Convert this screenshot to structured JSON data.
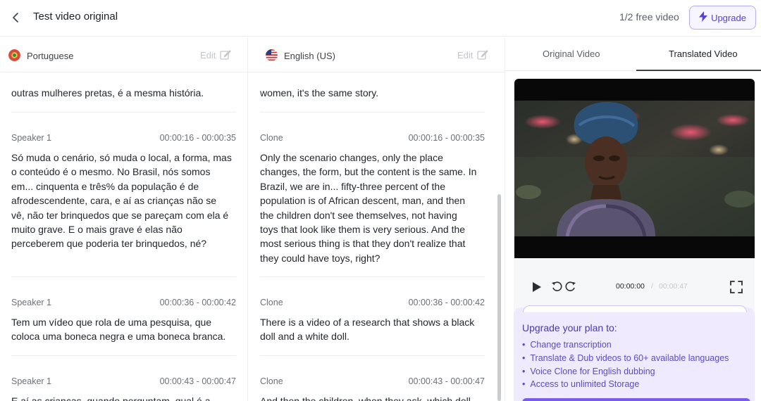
{
  "header": {
    "title": "Test video original",
    "free_count": "1/2 free video",
    "upgrade_label": "Upgrade"
  },
  "source": {
    "language": "Portuguese",
    "edit_label": "Edit",
    "top_fragment": "outras mulheres pretas, é a mesma história.",
    "segments": [
      {
        "speaker": "Speaker 1",
        "time": "00:00:16 - 00:00:35",
        "lines": [
          "Só muda o cenário, só muda o local, a forma, mas",
          "o conteúdo é o mesmo. No Brasil, nós somos",
          "em... cinquenta e três% da população é de",
          "afrodescendente, cara, e aí as crianças não se",
          "vê, não ter brinquedos que se pareçam com ela é",
          "muito grave. E o mais grave é elas não",
          "perceberem que poderia ter brinquedos, né?"
        ]
      },
      {
        "speaker": "Speaker 1",
        "time": "00:00:36 - 00:00:42",
        "lines": [
          "Tem um vídeo que rola de uma pesquisa, que",
          "coloca uma boneca negra e uma boneca branca."
        ]
      },
      {
        "speaker": "Speaker 1",
        "time": "00:00:43 - 00:00:47",
        "lines": [
          "E aí as crianças, quando perguntam, qual é a"
        ]
      }
    ]
  },
  "target": {
    "language": "English (US)",
    "edit_label": "Edit",
    "top_fragment": "women, it's the same story.",
    "segments": [
      {
        "speaker": "Clone",
        "time": "00:00:16 - 00:00:35",
        "lines": [
          "Only the scenario changes, only the place",
          "changes, the form, but the content is the same. In",
          "Brazil, we are in... fifty-three percent of the",
          "population is of African descent, man, and then",
          "the children don't see themselves, not having",
          "toys that look like them is very serious. And the",
          "most serious thing is that they don't realize that",
          "they could have toys, right?"
        ]
      },
      {
        "speaker": "Clone",
        "time": "00:00:36 - 00:00:42",
        "lines": [
          "There is a video of a research that shows a black",
          "doll and a white doll."
        ]
      },
      {
        "speaker": "Clone",
        "time": "00:00:43 - 00:00:47",
        "lines": [
          "And then the children, when they ask, which doll"
        ]
      }
    ]
  },
  "preview": {
    "tabs": [
      "Original Video",
      "Translated Video"
    ],
    "active_tab": "Translated Video",
    "current_time": "00:00:00",
    "separator": "/",
    "total_time": "00:00:47",
    "icons": [
      "play-icon",
      "rewind-icon",
      "forward-icon",
      "fullscreen-icon"
    ]
  },
  "upgrade_card": {
    "title": "Upgrade your plan to:",
    "items": [
      "Change transcription",
      "Translate & Dub videos to 60+ available languages",
      "Voice Clone for English dubbing",
      "Access to unlimited Storage"
    ]
  },
  "colors": {
    "accent": "#6c4fe0",
    "card_bg": "#efeafd",
    "divider": "#eceef1"
  }
}
